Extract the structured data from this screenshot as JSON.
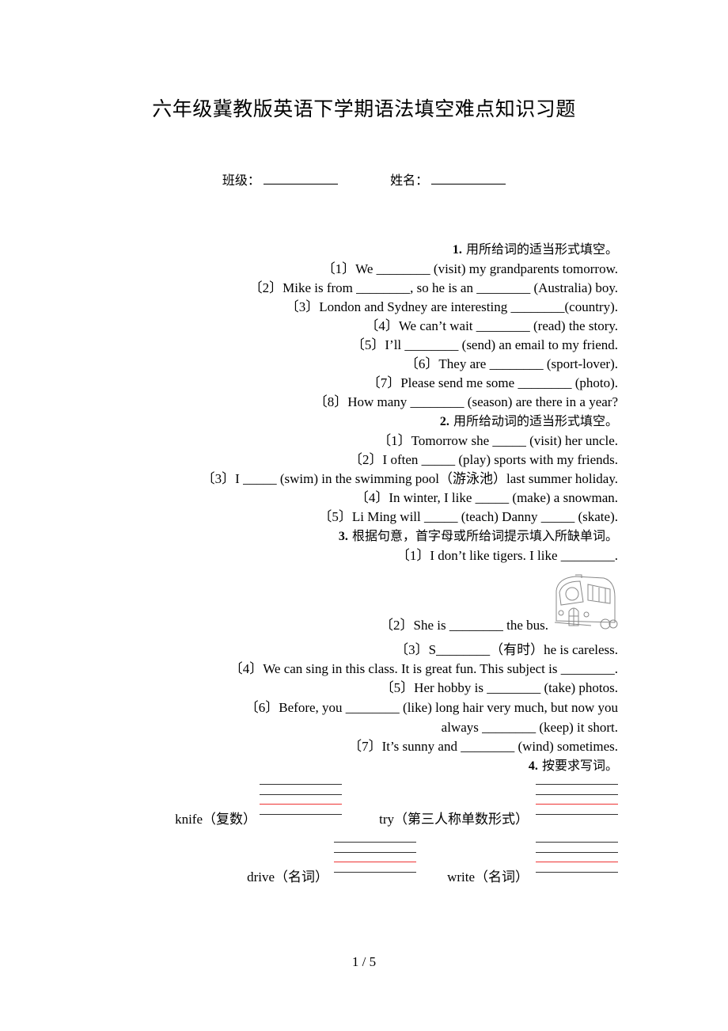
{
  "title": "六年级冀教版英语下学期语法填空难点知识习题",
  "meta": {
    "class_label": "班级：",
    "name_label": "姓名："
  },
  "section1": {
    "number": "1.",
    "heading": "用所给词的适当形式填空。",
    "items": [
      "〔1〕We ________ (visit) my grandparents tomorrow.",
      "〔2〕Mike is from ________, so he is an ________ (Australia) boy.",
      "〔3〕London and Sydney are interesting ________(country).",
      "〔4〕We can’t wait ________ (read) the story.",
      "〔5〕I’ll ________ (send) an email to my friend.",
      "〔6〕They are ________ (sport-lover).",
      "〔7〕Please send me some ________ (photo).",
      "〔8〕How many ________ (season) are there in a year?"
    ]
  },
  "section2": {
    "number": "2.",
    "heading": "用所给动词的适当形式填空。",
    "items": [
      "〔1〕Tomorrow she _____ (visit) her uncle.",
      "〔2〕I often _____ (play) sports with my friends.",
      "〔3〕I _____ (swim) in the swimming pool（游泳池）last summer holiday.",
      "〔4〕In winter, I like _____ (make) a snowman.",
      "〔5〕Li Ming will _____ (teach) Danny _____ (skate)."
    ]
  },
  "section3": {
    "number": "3.",
    "heading": "根据句意，首字母或所给词提示填入所缺单词。",
    "item1": "〔1〕I don’t like tigers. I like ________.",
    "item2": "〔2〕She is ________ the bus.",
    "image_icon": "bus-illustration",
    "items_rest": [
      "〔3〕S________（有时）he is careless.",
      "〔4〕We can sing in this class. It is great fun. This subject is ________.",
      "〔5〕Her hobby is ________ (take) photos.",
      "〔6〕Before, you ________ (like) long hair very much, but now you",
      "always ________ (keep) it short.",
      "〔7〕It’s sunny and ________ (wind) sometimes."
    ]
  },
  "section4": {
    "number": "4.",
    "heading": "按要求写词。",
    "words": [
      {
        "label": "knife（复数）"
      },
      {
        "label": "try（第三人称单数形式）"
      },
      {
        "label": "drive（名词）"
      },
      {
        "label": "write（名词）"
      }
    ],
    "line_colors": {
      "normal": "#333333",
      "guide": "#ee3333"
    }
  },
  "page_number": "1 / 5"
}
